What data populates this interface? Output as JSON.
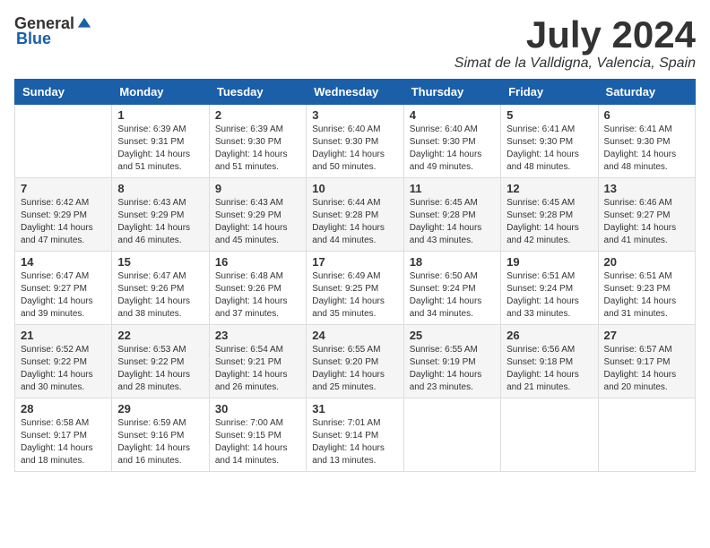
{
  "header": {
    "logo_general": "General",
    "logo_blue": "Blue",
    "month_title": "July 2024",
    "location": "Simat de la Valldigna, Valencia, Spain"
  },
  "days_of_week": [
    "Sunday",
    "Monday",
    "Tuesday",
    "Wednesday",
    "Thursday",
    "Friday",
    "Saturday"
  ],
  "weeks": [
    [
      {
        "day": "",
        "info": ""
      },
      {
        "day": "1",
        "info": "Sunrise: 6:39 AM\nSunset: 9:31 PM\nDaylight: 14 hours\nand 51 minutes."
      },
      {
        "day": "2",
        "info": "Sunrise: 6:39 AM\nSunset: 9:30 PM\nDaylight: 14 hours\nand 51 minutes."
      },
      {
        "day": "3",
        "info": "Sunrise: 6:40 AM\nSunset: 9:30 PM\nDaylight: 14 hours\nand 50 minutes."
      },
      {
        "day": "4",
        "info": "Sunrise: 6:40 AM\nSunset: 9:30 PM\nDaylight: 14 hours\nand 49 minutes."
      },
      {
        "day": "5",
        "info": "Sunrise: 6:41 AM\nSunset: 9:30 PM\nDaylight: 14 hours\nand 48 minutes."
      },
      {
        "day": "6",
        "info": "Sunrise: 6:41 AM\nSunset: 9:30 PM\nDaylight: 14 hours\nand 48 minutes."
      }
    ],
    [
      {
        "day": "7",
        "info": "Sunrise: 6:42 AM\nSunset: 9:29 PM\nDaylight: 14 hours\nand 47 minutes."
      },
      {
        "day": "8",
        "info": "Sunrise: 6:43 AM\nSunset: 9:29 PM\nDaylight: 14 hours\nand 46 minutes."
      },
      {
        "day": "9",
        "info": "Sunrise: 6:43 AM\nSunset: 9:29 PM\nDaylight: 14 hours\nand 45 minutes."
      },
      {
        "day": "10",
        "info": "Sunrise: 6:44 AM\nSunset: 9:28 PM\nDaylight: 14 hours\nand 44 minutes."
      },
      {
        "day": "11",
        "info": "Sunrise: 6:45 AM\nSunset: 9:28 PM\nDaylight: 14 hours\nand 43 minutes."
      },
      {
        "day": "12",
        "info": "Sunrise: 6:45 AM\nSunset: 9:28 PM\nDaylight: 14 hours\nand 42 minutes."
      },
      {
        "day": "13",
        "info": "Sunrise: 6:46 AM\nSunset: 9:27 PM\nDaylight: 14 hours\nand 41 minutes."
      }
    ],
    [
      {
        "day": "14",
        "info": "Sunrise: 6:47 AM\nSunset: 9:27 PM\nDaylight: 14 hours\nand 39 minutes."
      },
      {
        "day": "15",
        "info": "Sunrise: 6:47 AM\nSunset: 9:26 PM\nDaylight: 14 hours\nand 38 minutes."
      },
      {
        "day": "16",
        "info": "Sunrise: 6:48 AM\nSunset: 9:26 PM\nDaylight: 14 hours\nand 37 minutes."
      },
      {
        "day": "17",
        "info": "Sunrise: 6:49 AM\nSunset: 9:25 PM\nDaylight: 14 hours\nand 35 minutes."
      },
      {
        "day": "18",
        "info": "Sunrise: 6:50 AM\nSunset: 9:24 PM\nDaylight: 14 hours\nand 34 minutes."
      },
      {
        "day": "19",
        "info": "Sunrise: 6:51 AM\nSunset: 9:24 PM\nDaylight: 14 hours\nand 33 minutes."
      },
      {
        "day": "20",
        "info": "Sunrise: 6:51 AM\nSunset: 9:23 PM\nDaylight: 14 hours\nand 31 minutes."
      }
    ],
    [
      {
        "day": "21",
        "info": "Sunrise: 6:52 AM\nSunset: 9:22 PM\nDaylight: 14 hours\nand 30 minutes."
      },
      {
        "day": "22",
        "info": "Sunrise: 6:53 AM\nSunset: 9:22 PM\nDaylight: 14 hours\nand 28 minutes."
      },
      {
        "day": "23",
        "info": "Sunrise: 6:54 AM\nSunset: 9:21 PM\nDaylight: 14 hours\nand 26 minutes."
      },
      {
        "day": "24",
        "info": "Sunrise: 6:55 AM\nSunset: 9:20 PM\nDaylight: 14 hours\nand 25 minutes."
      },
      {
        "day": "25",
        "info": "Sunrise: 6:55 AM\nSunset: 9:19 PM\nDaylight: 14 hours\nand 23 minutes."
      },
      {
        "day": "26",
        "info": "Sunrise: 6:56 AM\nSunset: 9:18 PM\nDaylight: 14 hours\nand 21 minutes."
      },
      {
        "day": "27",
        "info": "Sunrise: 6:57 AM\nSunset: 9:17 PM\nDaylight: 14 hours\nand 20 minutes."
      }
    ],
    [
      {
        "day": "28",
        "info": "Sunrise: 6:58 AM\nSunset: 9:17 PM\nDaylight: 14 hours\nand 18 minutes."
      },
      {
        "day": "29",
        "info": "Sunrise: 6:59 AM\nSunset: 9:16 PM\nDaylight: 14 hours\nand 16 minutes."
      },
      {
        "day": "30",
        "info": "Sunrise: 7:00 AM\nSunset: 9:15 PM\nDaylight: 14 hours\nand 14 minutes."
      },
      {
        "day": "31",
        "info": "Sunrise: 7:01 AM\nSunset: 9:14 PM\nDaylight: 14 hours\nand 13 minutes."
      },
      {
        "day": "",
        "info": ""
      },
      {
        "day": "",
        "info": ""
      },
      {
        "day": "",
        "info": ""
      }
    ]
  ]
}
